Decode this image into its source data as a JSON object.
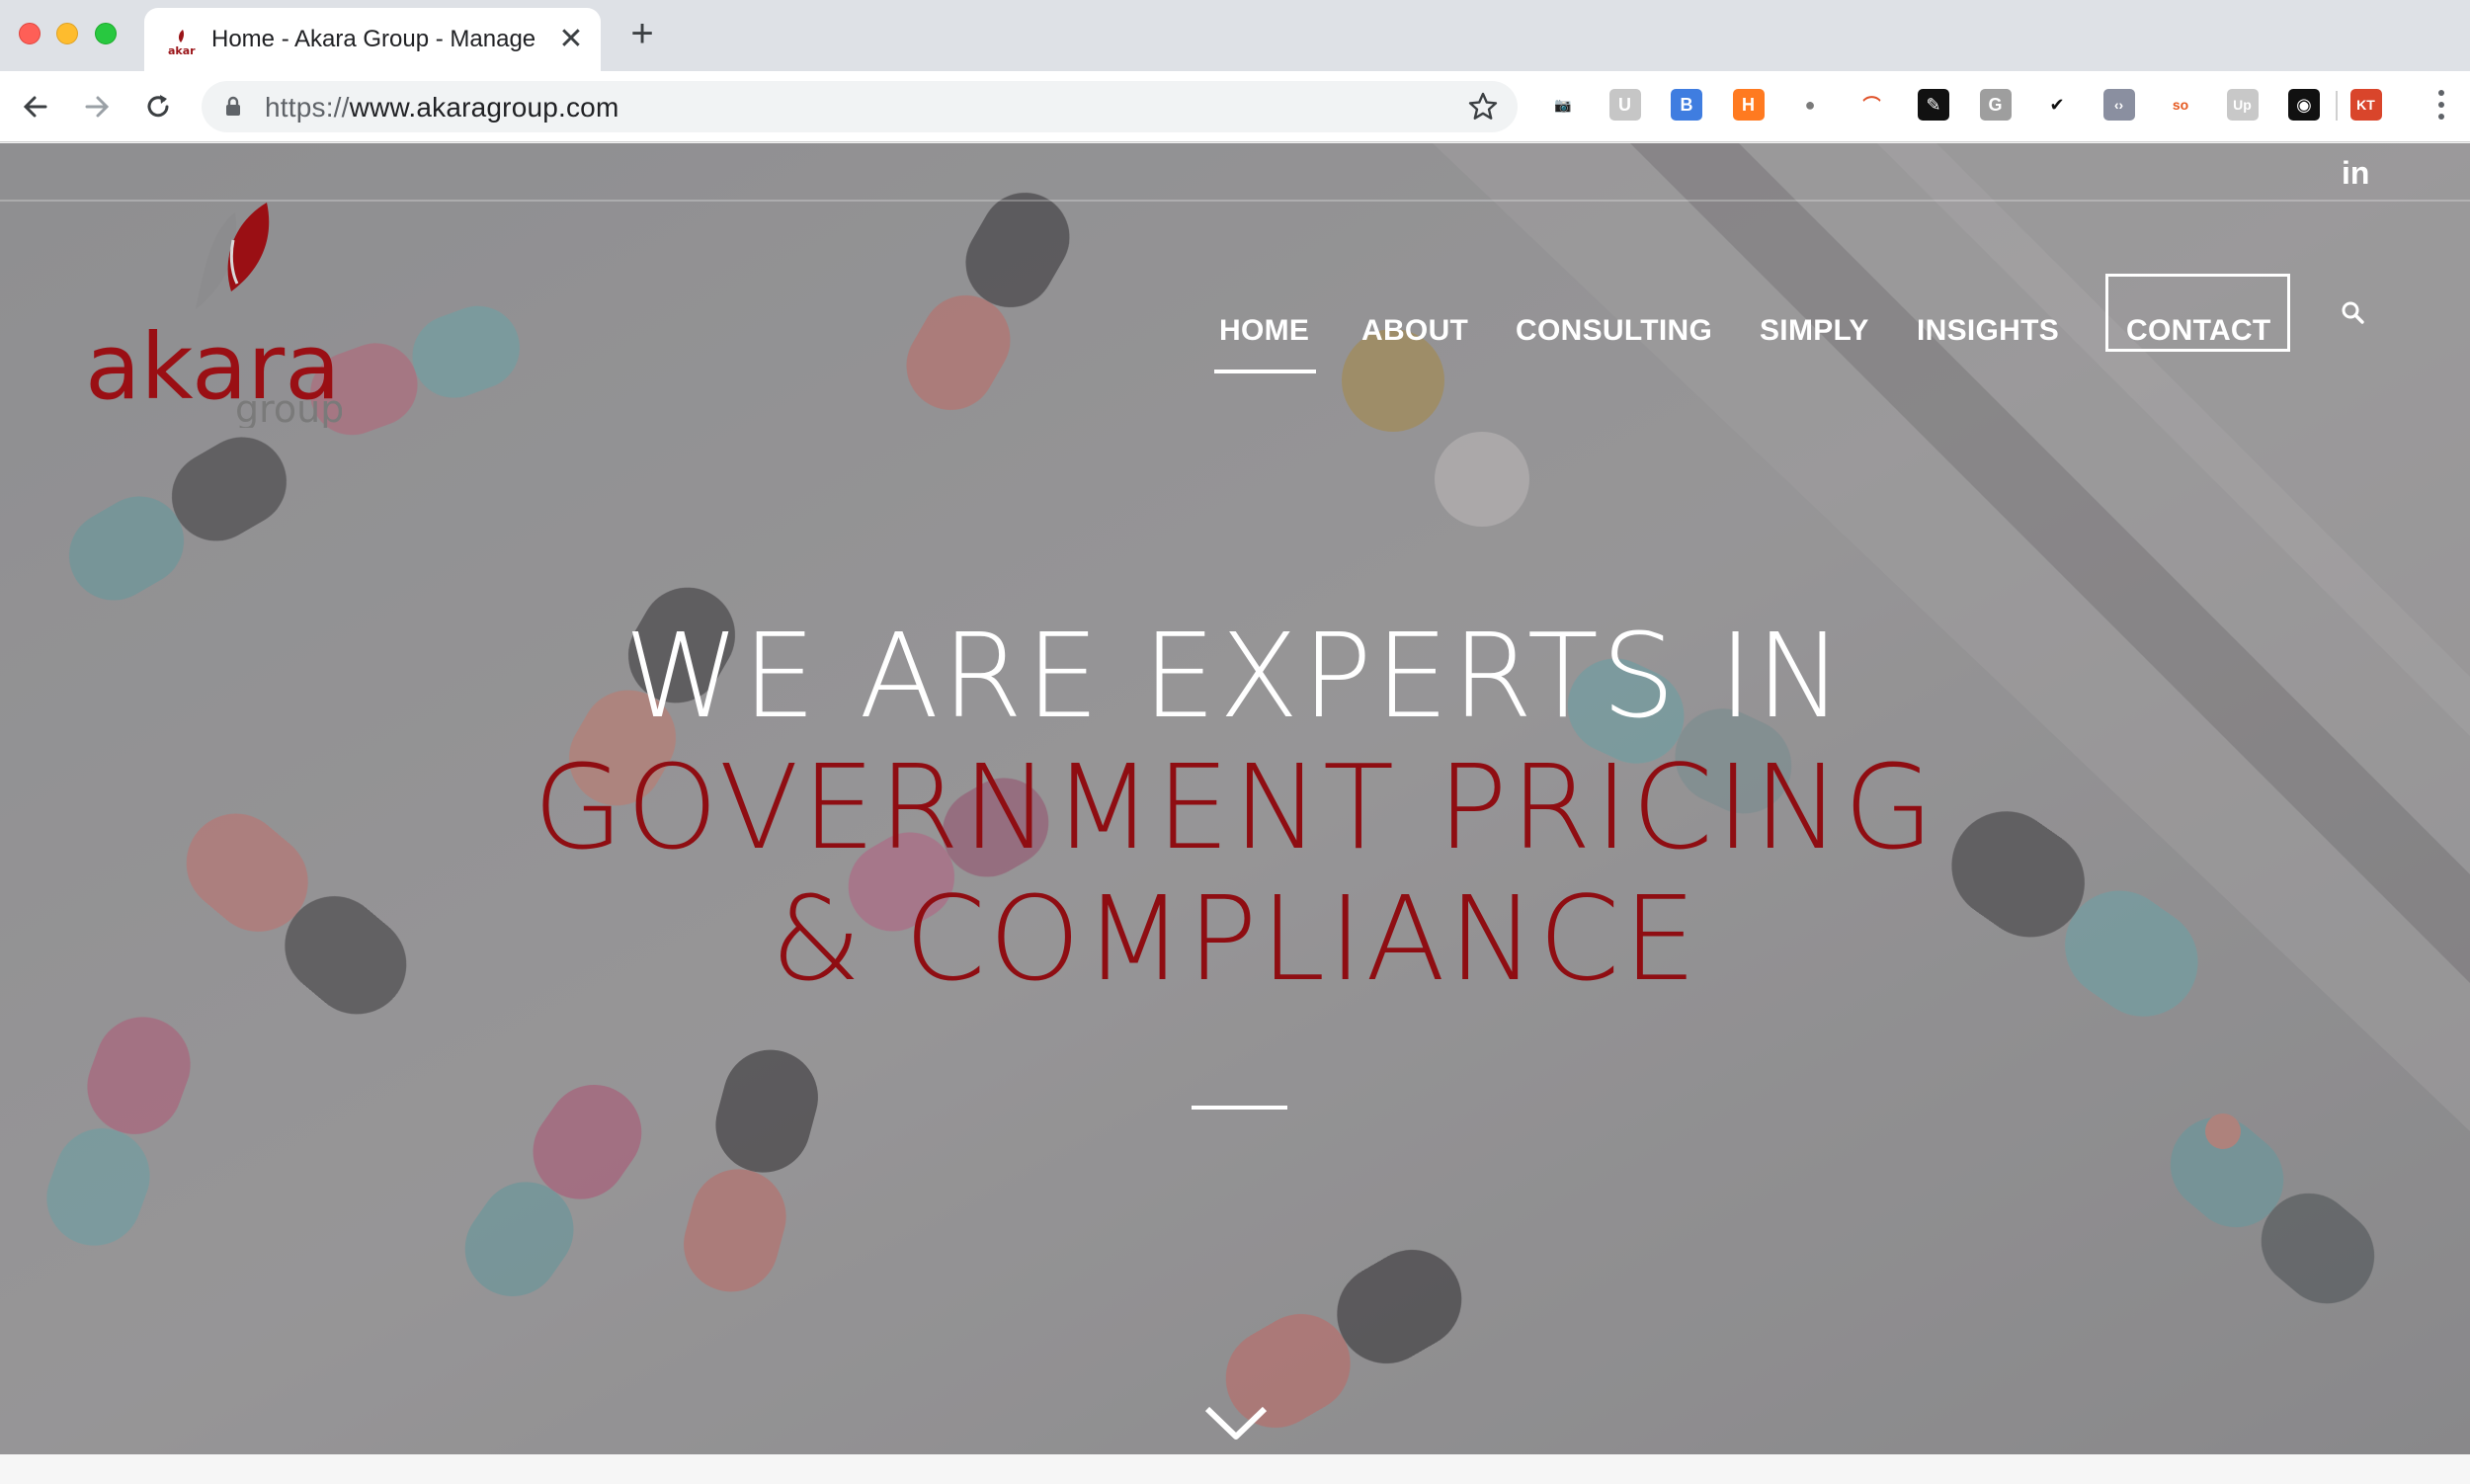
{
  "browser": {
    "tab_title": "Home - Akara Group - Manage",
    "tab_close": "✕",
    "new_tab": "+",
    "url_scheme": "https://",
    "url_host": "www.akaragroup.com"
  },
  "extensions": [
    {
      "name": "camera-icon",
      "glyph": "📷",
      "bg": "transparent",
      "color": "#5f6368"
    },
    {
      "name": "extension-u-icon",
      "glyph": "U",
      "bg": "#c6c6c6",
      "color": "#ffffff"
    },
    {
      "name": "extension-blue-icon",
      "glyph": "B",
      "bg": "#3f7de0",
      "color": "#ffffff"
    },
    {
      "name": "hubspot-icon",
      "glyph": "H",
      "bg": "#ff7a20",
      "color": "#ffffff"
    },
    {
      "name": "extension-circle-icon",
      "glyph": "●",
      "bg": "transparent",
      "color": "#7a7a7a"
    },
    {
      "name": "extension-rainbow-icon",
      "glyph": "⌒",
      "bg": "transparent",
      "color": "#e0522a"
    },
    {
      "name": "pen-icon",
      "glyph": "✎",
      "bg": "#111111",
      "color": "#ffffff"
    },
    {
      "name": "extension-g-icon",
      "glyph": "G",
      "bg": "#9e9e9e",
      "color": "#ffffff"
    },
    {
      "name": "checkmark-icon",
      "glyph": "✔",
      "bg": "transparent",
      "color": "#111111"
    },
    {
      "name": "code-icon",
      "glyph": "‹›",
      "bg": "#8a8fa0",
      "color": "#ffffff"
    },
    {
      "name": "extension-so-icon",
      "glyph": "so",
      "bg": "transparent",
      "color": "#e55a21"
    },
    {
      "name": "extension-up-icon",
      "glyph": "Up",
      "bg": "#c8c8c8",
      "color": "#ffffff"
    },
    {
      "name": "extension-dark-icon",
      "glyph": "◉",
      "bg": "#111111",
      "color": "#ffffff"
    },
    {
      "name": "extension-fox-icon",
      "glyph": "KT",
      "bg": "#d9452b",
      "color": "#ffffff"
    }
  ],
  "site": {
    "logo_word": "akara",
    "logo_sub": "group",
    "social": "in",
    "nav": [
      "HOME",
      "ABOUT",
      "CONSULTING",
      "SIMPLY",
      "INSIGHTS",
      "CONTACT"
    ],
    "headline_line1": "WE ARE EXPERTS IN",
    "headline_line2": "GOVERNMENT PRICING",
    "headline_line3": "& COMPLIANCE"
  },
  "colors": {
    "brand_red": "#8f0d12",
    "hero_overlay": "#6e6e70"
  }
}
